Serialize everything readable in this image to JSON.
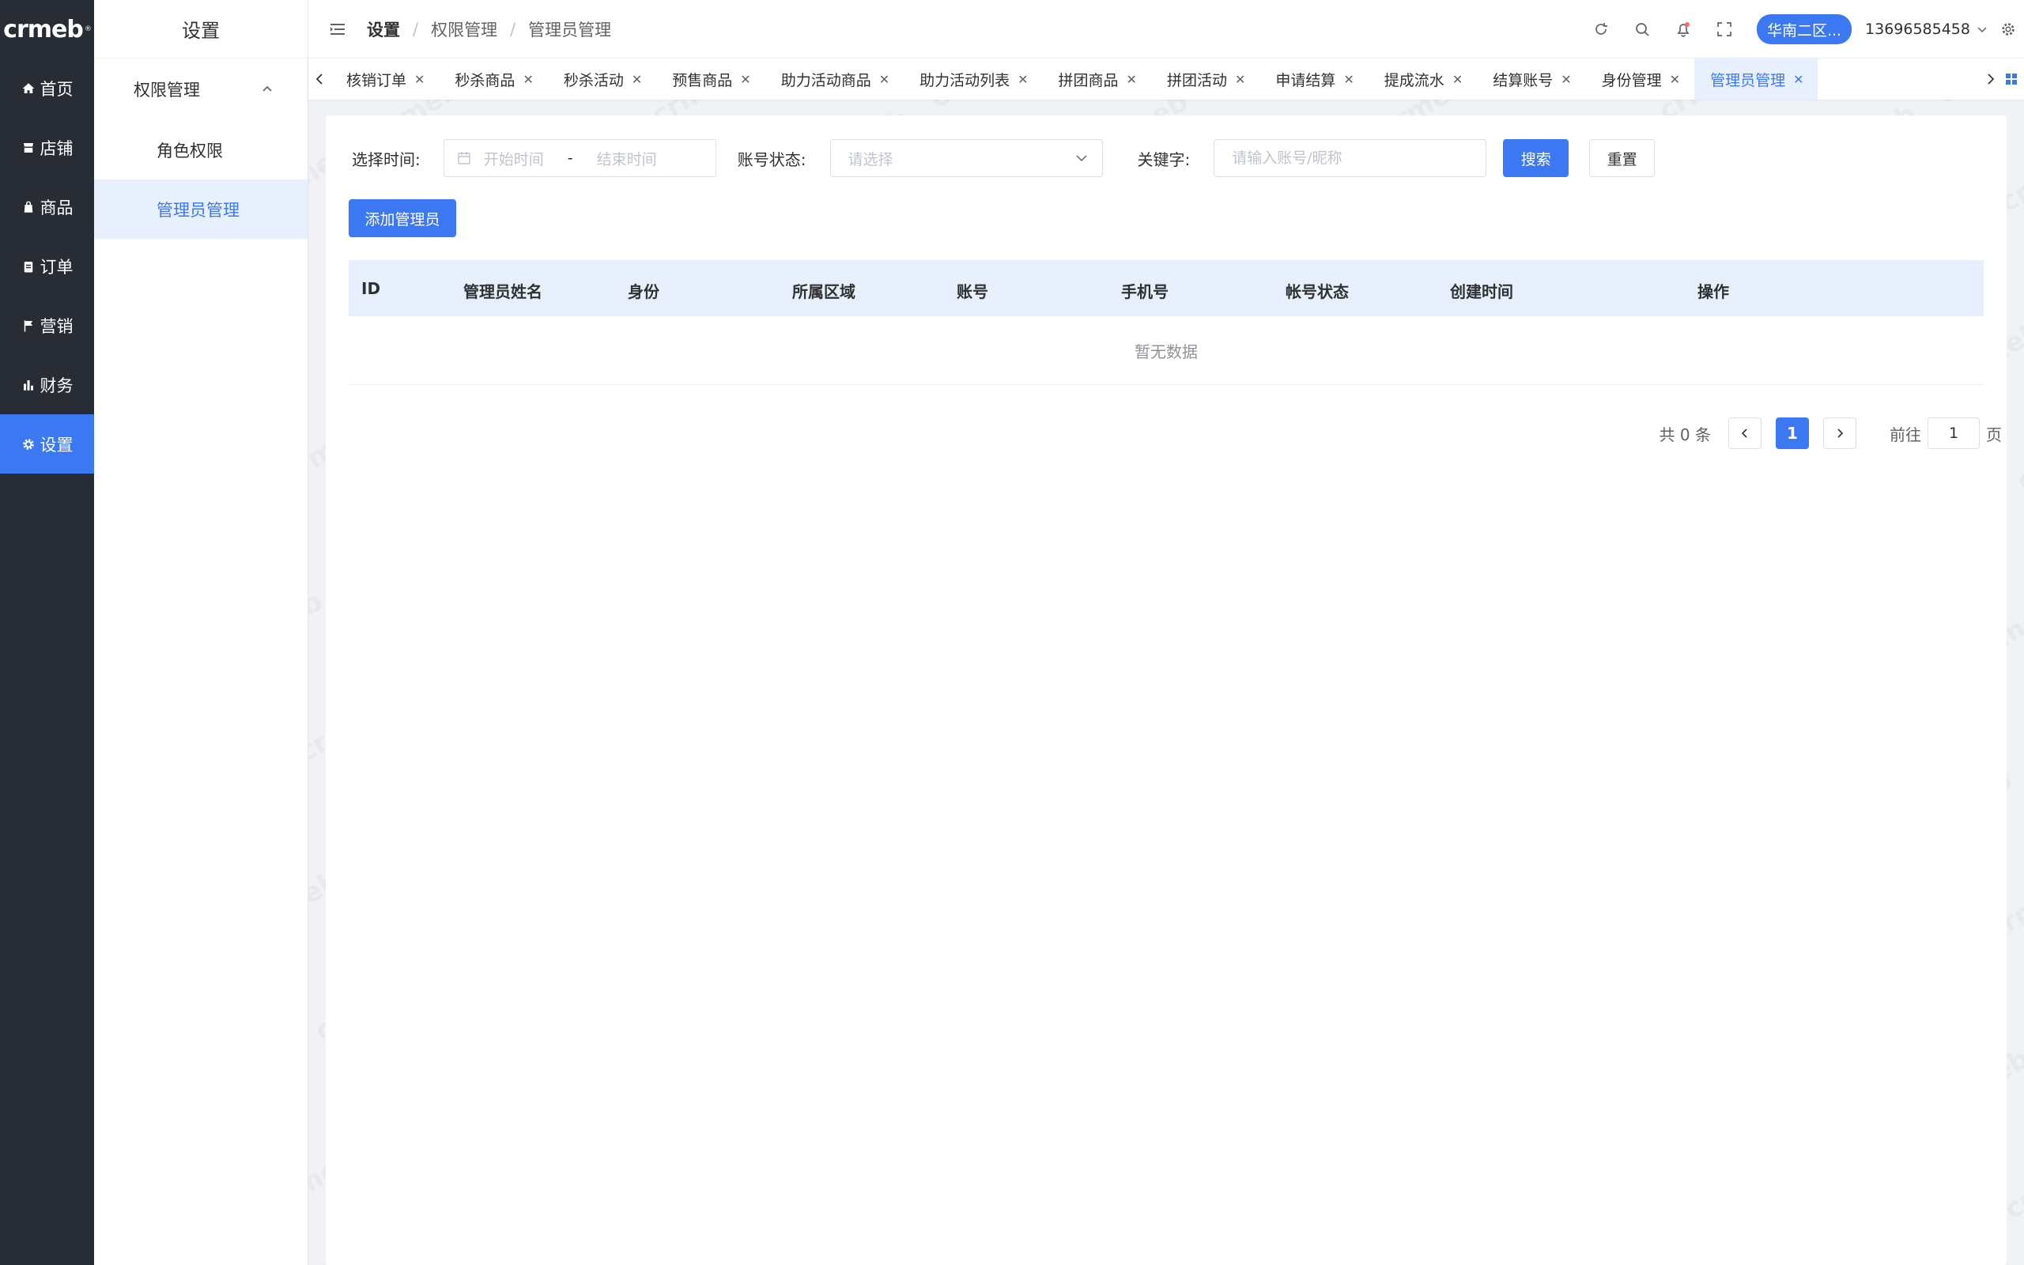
{
  "app": {
    "logo_text": "crmeb",
    "logo_mark": "®",
    "colors": {
      "primary": "#3c78f2",
      "rail_bg": "#282c34",
      "active_bg": "#e8f0fe"
    }
  },
  "rail": {
    "items": [
      {
        "label": "首页",
        "icon": "home-icon"
      },
      {
        "label": "店铺",
        "icon": "store-icon"
      },
      {
        "label": "商品",
        "icon": "bag-icon"
      },
      {
        "label": "订单",
        "icon": "clipboard-icon"
      },
      {
        "label": "营销",
        "icon": "flag-icon"
      },
      {
        "label": "财务",
        "icon": "bar-chart-icon"
      },
      {
        "label": "设置",
        "icon": "gear-icon",
        "active": true
      }
    ]
  },
  "submenu": {
    "title": "设置",
    "group_label": "权限管理",
    "items": [
      {
        "label": "角色权限"
      },
      {
        "label": "管理员管理",
        "active": true
      }
    ]
  },
  "header": {
    "breadcrumb": [
      "设置",
      "权限管理",
      "管理员管理"
    ],
    "region_label": "华南二区...",
    "username": "13696585458"
  },
  "tabs": {
    "items": [
      "核销订单",
      "秒杀商品",
      "秒杀活动",
      "预售商品",
      "助力活动商品",
      "助力活动列表",
      "拼团商品",
      "拼团活动",
      "申请结算",
      "提成流水",
      "结算账号",
      "身份管理",
      "管理员管理"
    ],
    "active_index": 12
  },
  "filters": {
    "time_label": "选择时间:",
    "start_placeholder": "开始时间",
    "range_separator": "-",
    "end_placeholder": "结束时间",
    "status_label": "账号状态:",
    "status_placeholder": "请选择",
    "keyword_label": "关键字:",
    "keyword_placeholder": "请输入账号/昵称",
    "search_button": "搜索",
    "reset_button": "重置"
  },
  "actions": {
    "add_admin": "添加管理员"
  },
  "table": {
    "columns": [
      "ID",
      "管理员姓名",
      "身份",
      "所属区域",
      "账号",
      "手机号",
      "帐号状态",
      "创建时间",
      "操作"
    ],
    "empty_text": "暂无数据"
  },
  "pagination": {
    "total_text": "共 0 条",
    "current_page": "1",
    "goto_label": "前往",
    "goto_value": "1",
    "page_suffix": "页"
  }
}
